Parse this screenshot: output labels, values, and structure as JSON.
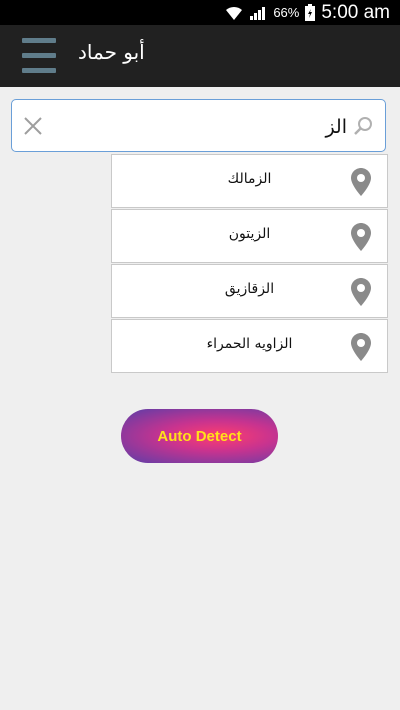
{
  "status_bar": {
    "battery_percent": "66%",
    "time": "5:00 am"
  },
  "toolbar": {
    "title": "أبو حماد"
  },
  "search": {
    "value": "الز"
  },
  "suggestions": [
    {
      "label": "الزمالك"
    },
    {
      "label": "الزيتون"
    },
    {
      "label": "الزقازيق"
    },
    {
      "label": "الزاويه الحمراء"
    }
  ],
  "auto_detect": {
    "label": "Auto Detect",
    "text_color": "#ffe11a"
  },
  "colors": {
    "toolbar_bg": "#212121",
    "menu_icon": "#607d8b",
    "search_border": "#6a9fd8",
    "pin_icon": "#8a8a8a"
  },
  "icons": {
    "menu": "hamburger-menu-icon",
    "clear": "close-x-icon",
    "search": "magnifier-icon",
    "pin": "location-pin-icon"
  }
}
